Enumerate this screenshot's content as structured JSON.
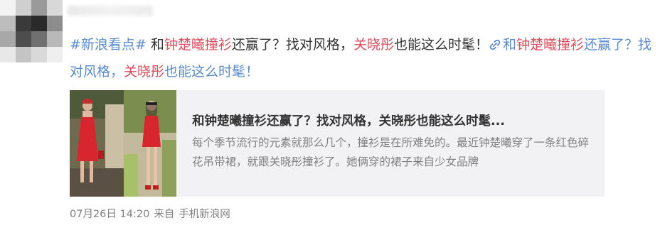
{
  "post": {
    "hashtag": "#新浪看点#",
    "t1": " 和",
    "kw1": "钟楚曦",
    "t2": "撞衫",
    "t3": "还赢了？找对风格，",
    "kw2": "关晓彤",
    "t4": "也能这么时髦！",
    "link_icon": "link-icon",
    "link_t1": "和",
    "link_kw1": "钟楚曦",
    "link_t2": "撞衫",
    "link_t3": "还赢了？找对风格，",
    "link_kw2": "关晓彤",
    "link_t4": "也能这么时髦！"
  },
  "card": {
    "title": "和钟楚曦撞衫还赢了？找对风格，关晓彤也能这么时髦...",
    "description": "每个季节流行的元素就那么几个，撞衫是在所难免的。最近钟楚曦穿了一条红色碎花吊带裙，就跟关晓彤撞衫了。她俩穿的裙子来自少女品牌"
  },
  "meta": {
    "date": "07月26日 14:20",
    "from_label": "来自",
    "source": "手机新浪网"
  },
  "colors": {
    "hashtag": "#eb7350",
    "keyword": "#d94d5c",
    "link": "#5b8bcc",
    "card_bg": "#f2f2f5",
    "meta": "#808080"
  }
}
